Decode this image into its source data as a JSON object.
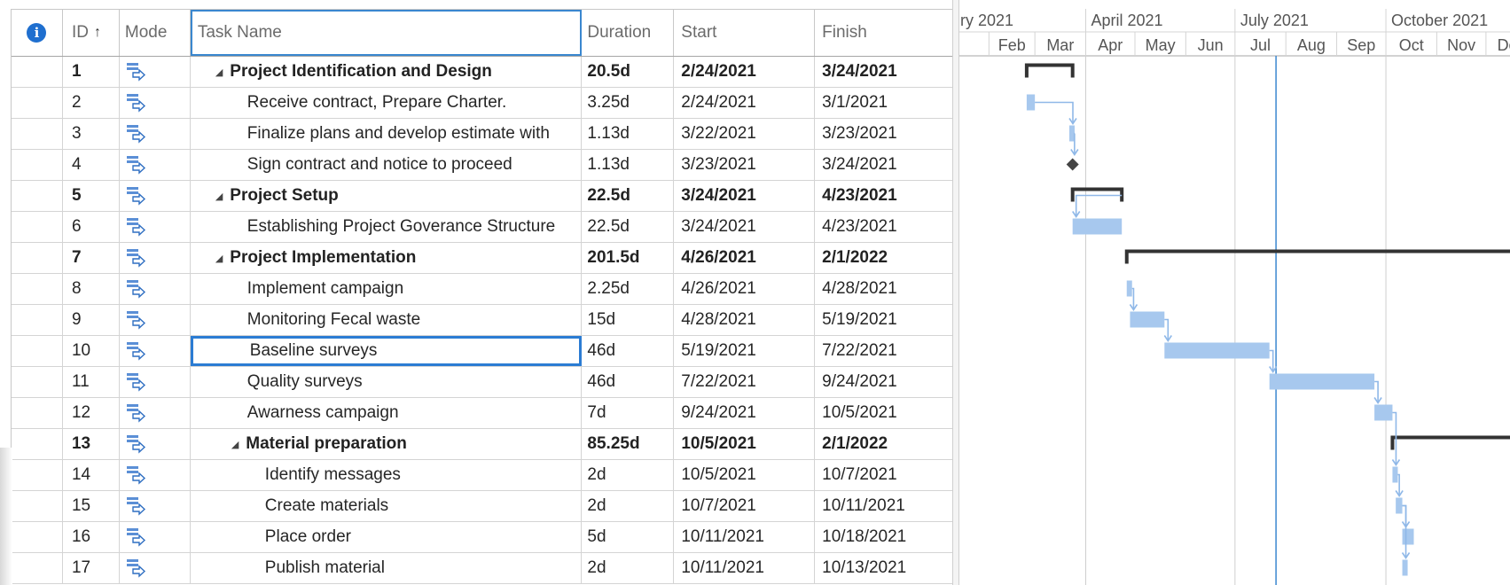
{
  "columns": {
    "indicators": "i",
    "id": "ID",
    "id_sort": "↑",
    "mode": "Mode",
    "name": "Task Name",
    "duration": "Duration",
    "start": "Start",
    "finish": "Finish"
  },
  "tasks": [
    {
      "id": "1",
      "name": "Project Identification and Design",
      "duration": "20.5d",
      "start": "2/24/2021",
      "finish": "3/24/2021",
      "summary": true,
      "level": 1
    },
    {
      "id": "2",
      "name": "Receive contract, Prepare Charter.",
      "duration": "3.25d",
      "start": "2/24/2021",
      "finish": "3/1/2021",
      "summary": false,
      "level": 2
    },
    {
      "id": "3",
      "name": "Finalize plans and develop estimate with",
      "duration": "1.13d",
      "start": "3/22/2021",
      "finish": "3/23/2021",
      "summary": false,
      "level": 2
    },
    {
      "id": "4",
      "name": "Sign contract and notice to proceed",
      "duration": "1.13d",
      "start": "3/23/2021",
      "finish": "3/24/2021",
      "summary": false,
      "level": 2
    },
    {
      "id": "5",
      "name": "Project Setup",
      "duration": "22.5d",
      "start": "3/24/2021",
      "finish": "4/23/2021",
      "summary": true,
      "level": 1
    },
    {
      "id": "6",
      "name": "Establishing Project Goverance Structure",
      "duration": "22.5d",
      "start": "3/24/2021",
      "finish": "4/23/2021",
      "summary": false,
      "level": 2
    },
    {
      "id": "7",
      "name": "Project Implementation",
      "duration": "201.5d",
      "start": "4/26/2021",
      "finish": "2/1/2022",
      "summary": true,
      "level": 1
    },
    {
      "id": "8",
      "name": "Implement campaign",
      "duration": "2.25d",
      "start": "4/26/2021",
      "finish": "4/28/2021",
      "summary": false,
      "level": 2
    },
    {
      "id": "9",
      "name": "Monitoring Fecal waste",
      "duration": "15d",
      "start": "4/28/2021",
      "finish": "5/19/2021",
      "summary": false,
      "level": 2
    },
    {
      "id": "10",
      "name": "Baseline surveys",
      "duration": "46d",
      "start": "5/19/2021",
      "finish": "7/22/2021",
      "summary": false,
      "level": 2,
      "selected": true
    },
    {
      "id": "11",
      "name": "Quality surveys",
      "duration": "46d",
      "start": "7/22/2021",
      "finish": "9/24/2021",
      "summary": false,
      "level": 2
    },
    {
      "id": "12",
      "name": "Awarness campaign",
      "duration": "7d",
      "start": "9/24/2021",
      "finish": "10/5/2021",
      "summary": false,
      "level": 2
    },
    {
      "id": "13",
      "name": "Material preparation",
      "duration": "85.25d",
      "start": "10/5/2021",
      "finish": "2/1/2022",
      "summary": true,
      "level": 2
    },
    {
      "id": "14",
      "name": "Identify messages",
      "duration": "2d",
      "start": "10/5/2021",
      "finish": "10/7/2021",
      "summary": false,
      "level": 3
    },
    {
      "id": "15",
      "name": "Create materials",
      "duration": "2d",
      "start": "10/7/2021",
      "finish": "10/11/2021",
      "summary": false,
      "level": 3
    },
    {
      "id": "16",
      "name": "Place order",
      "duration": "5d",
      "start": "10/11/2021",
      "finish": "10/18/2021",
      "summary": false,
      "level": 3
    },
    {
      "id": "17",
      "name": "Publish material",
      "duration": "2d",
      "start": "10/11/2021",
      "finish": "10/13/2021",
      "summary": false,
      "level": 3
    }
  ],
  "timeline": {
    "quarters": [
      "ry 2021",
      "April 2021",
      "July 2021",
      "October 2021"
    ],
    "months": [
      "Feb",
      "Mar",
      "Apr",
      "May",
      "Jun",
      "Jul",
      "Aug",
      "Sep",
      "Oct",
      "Nov",
      "Dec"
    ]
  },
  "colors": {
    "bar": "#a7c8ee",
    "link": "#8fb8e8",
    "summary": "#333333",
    "today_line": "#3a87cf",
    "selection": "#2b7cd3",
    "info_badge": "#1f6fcf"
  },
  "icons": {
    "indicators_header": "info-icon",
    "mode": "auto-scheduled-task-icon"
  }
}
